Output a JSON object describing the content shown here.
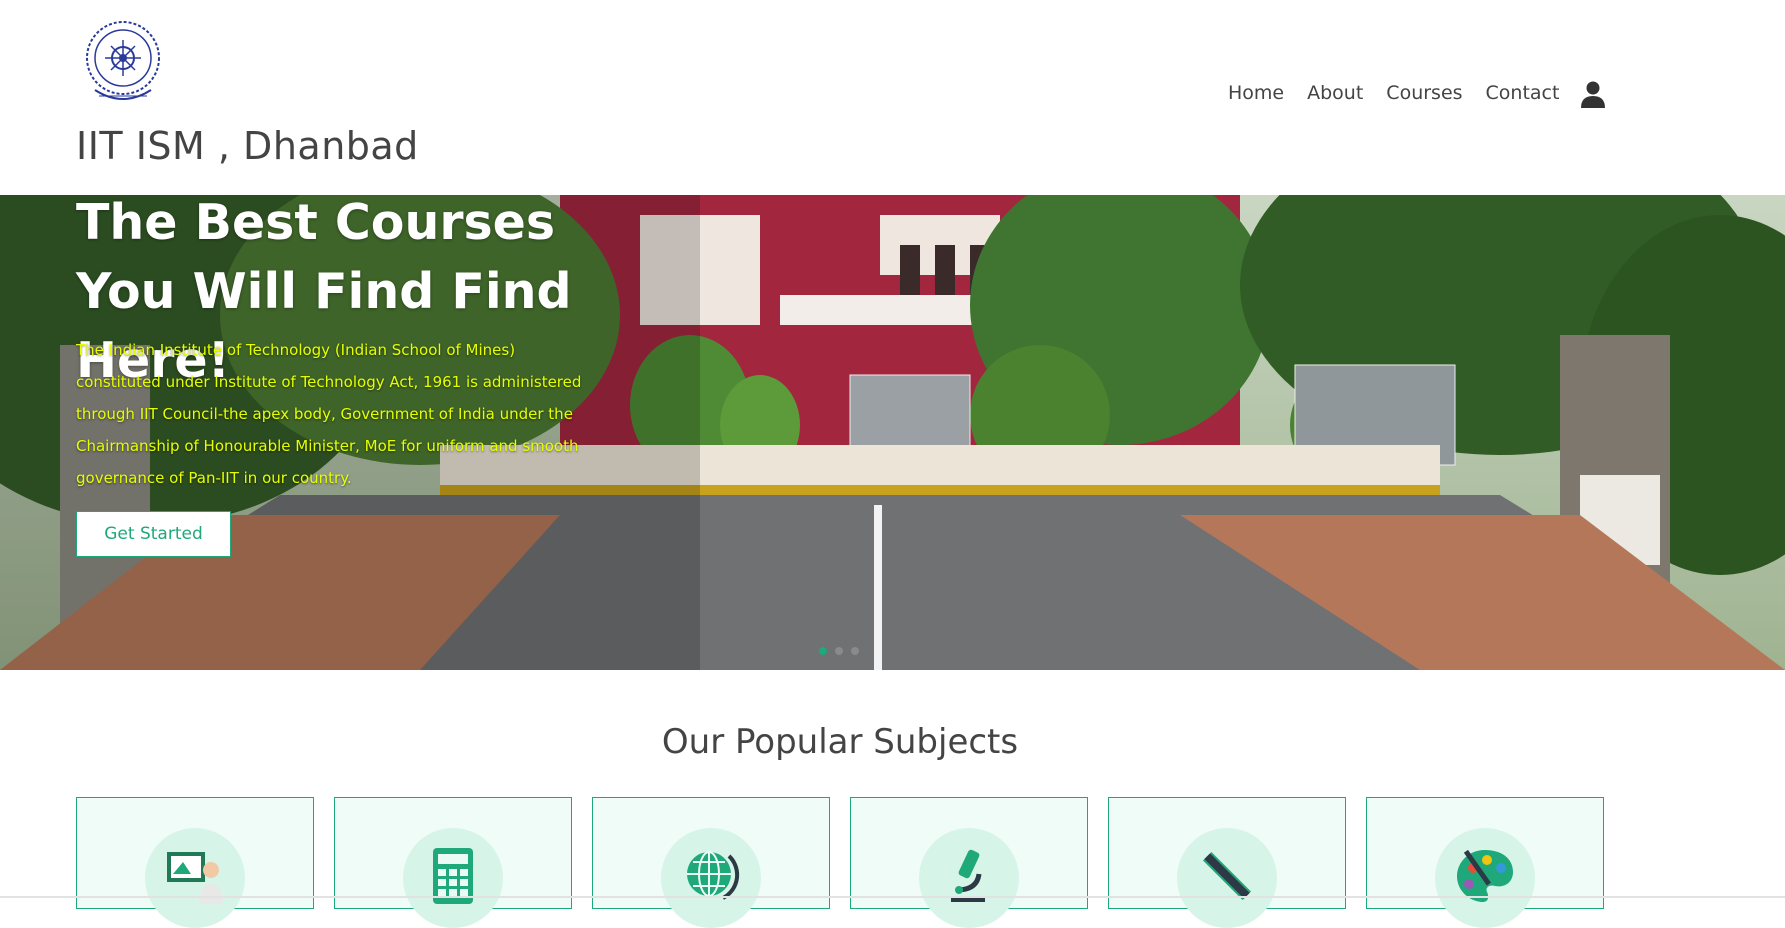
{
  "header": {
    "site_title": "IIT ISM , Dhanbad",
    "logo_icon": "iit-ism-emblem",
    "nav": [
      "Home",
      "About",
      "Courses",
      "Contact"
    ],
    "user_icon": "user-icon"
  },
  "hero": {
    "title": "The Best Courses You Will Find Find Here!",
    "text": "The Indian Institute of Technology (Indian School of Mines) constituted under Institute of Technology Act, 1961 is administered through IIT Council-the apex body, Government of India under the Chairmanship of Honourable Minister, MoE for uniform and smooth governance of Pan-IIT in our country.",
    "cta": "Get Started",
    "carousel_active": 0,
    "carousel_count": 3
  },
  "subjects": {
    "title": "Our Popular Subjects",
    "icons": [
      "teacher-board-icon",
      "calculator-icon",
      "globe-icon",
      "microscope-icon",
      "ruler-pencil-icon",
      "palette-icon"
    ]
  },
  "colors": {
    "accent": "#1fa87a",
    "hero_text": "#e6ff00",
    "card_bg": "#effcf7"
  }
}
